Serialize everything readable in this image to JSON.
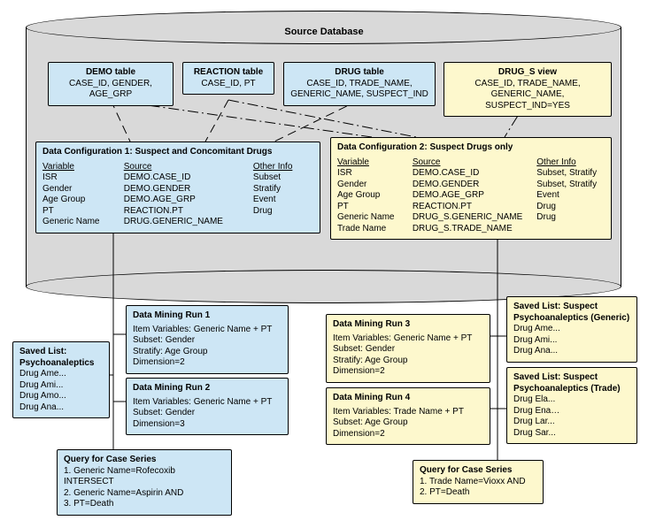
{
  "db_title": "Source Database",
  "tables": {
    "demo": {
      "title": "DEMO table",
      "cols": "CASE_ID, GENDER, AGE_GRP"
    },
    "reaction": {
      "title": "REACTION table",
      "cols": "CASE_ID, PT"
    },
    "drug": {
      "title": "DRUG table",
      "cols": "CASE_ID, TRADE_NAME, GENERIC_NAME, SUSPECT_IND"
    },
    "drug_s": {
      "title": "DRUG_S view",
      "cols": "CASE_ID, TRADE_NAME, GENERIC_NAME, SUSPECT_IND=YES"
    }
  },
  "config1": {
    "title": "Data Configuration 1: Suspect and Concomitant Drugs",
    "headers": {
      "var": "Variable",
      "src": "Source",
      "info": "Other Info"
    },
    "rows": [
      {
        "var": "ISR",
        "src": "DEMO.CASE_ID",
        "info": ""
      },
      {
        "var": "Gender",
        "src": "DEMO.GENDER",
        "info": "Subset"
      },
      {
        "var": "Age Group",
        "src": "DEMO.AGE_GRP",
        "info": "Stratify"
      },
      {
        "var": "PT",
        "src": "REACTION.PT",
        "info": "Event"
      },
      {
        "var": "Generic Name",
        "src": "DRUG.GENERIC_NAME",
        "info": "Drug"
      }
    ]
  },
  "config2": {
    "title": "Data Configuration 2: Suspect Drugs only",
    "headers": {
      "var": "Variable",
      "src": "Source",
      "info": "Other Info"
    },
    "rows": [
      {
        "var": "ISR",
        "src": "DEMO.CASE_ID",
        "info": ""
      },
      {
        "var": "Gender",
        "src": "DEMO.GENDER",
        "info": "Subset, Stratify"
      },
      {
        "var": "Age Group",
        "src": "DEMO.AGE_GRP",
        "info": "Subset, Stratify"
      },
      {
        "var": "PT",
        "src": "REACTION.PT",
        "info": "Event"
      },
      {
        "var": "Generic Name",
        "src": "DRUG_S.GENERIC_NAME",
        "info": "Drug"
      },
      {
        "var": "Trade Name",
        "src": "DRUG_S.TRADE_NAME",
        "info": "Drug"
      }
    ]
  },
  "saved_lists": {
    "psycho": {
      "title": "Saved List: Psychoanaleptics",
      "items": [
        "Drug Ame...",
        "Drug Ami...",
        "Drug Amo...",
        "Drug Ana..."
      ]
    },
    "suspect_generic": {
      "title": "Saved List: Suspect Psychoanaleptics (Generic)",
      "items": [
        "Drug Ame...",
        "Drug Ami...",
        "Drug Ana..."
      ]
    },
    "suspect_trade": {
      "title": "Saved List: Suspect Psychoanaleptics (Trade)",
      "items": [
        "Drug Ela...",
        "Drug Ena…",
        "Drug Lar...",
        "Drug Sar..."
      ]
    }
  },
  "runs": {
    "r1": {
      "title": "Data Mining Run 1",
      "lines": [
        "Item Variables: Generic Name + PT",
        "Subset: Gender",
        "Stratify: Age Group",
        "Dimension=2"
      ]
    },
    "r2": {
      "title": "Data Mining Run 2",
      "lines": [
        "Item Variables: Generic Name + PT",
        "Subset: Gender",
        "Dimension=3"
      ]
    },
    "r3": {
      "title": "Data Mining Run 3",
      "lines": [
        "Item Variables: Generic Name + PT",
        "Subset: Gender",
        "Stratify: Age Group",
        "Dimension=2"
      ]
    },
    "r4": {
      "title": "Data Mining Run 4",
      "lines": [
        "Item Variables: Trade Name + PT",
        "Subset: Age Group",
        "Dimension=2"
      ]
    }
  },
  "queries": {
    "q1": {
      "title": "Query for Case Series",
      "lines": [
        "1. Generic Name=Rofecoxib INTERSECT",
        "2. Generic Name=Aspirin AND",
        "3. PT=Death"
      ]
    },
    "q2": {
      "title": "Query for Case Series",
      "lines": [
        "1. Trade Name=Vioxx AND",
        "2. PT=Death"
      ]
    }
  }
}
